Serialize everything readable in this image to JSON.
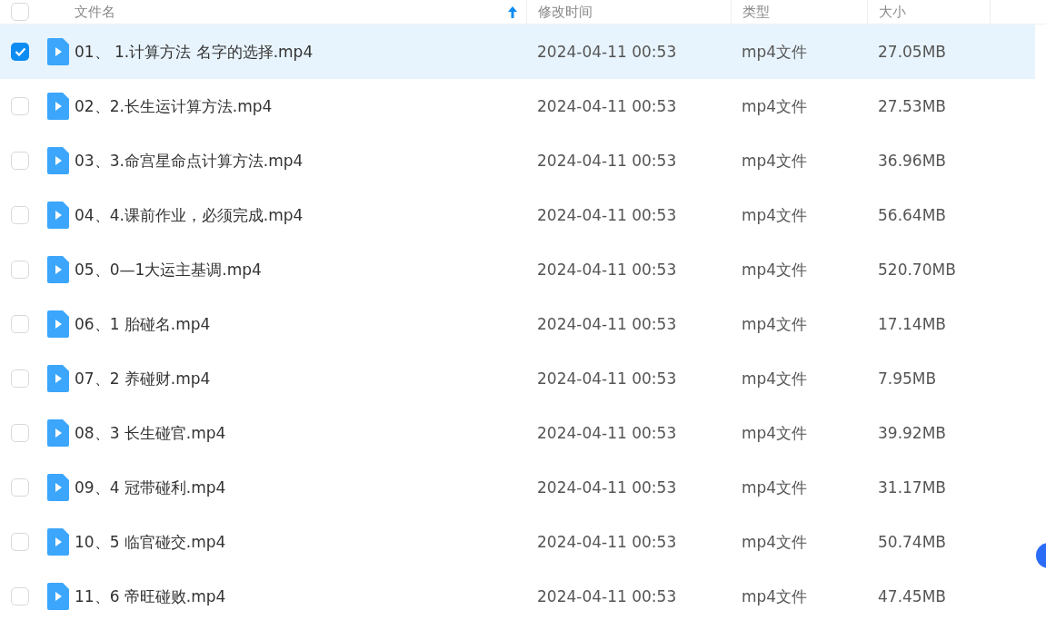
{
  "header": {
    "checked": false,
    "columns": [
      "文件名",
      "修改时间",
      "类型",
      "大小"
    ]
  },
  "rows": [
    {
      "name": "01、 1.计算方法 名字的选择.mp4",
      "modified": "2024-04-11 00:53",
      "type": "mp4文件",
      "size": "27.05MB",
      "selected": true
    },
    {
      "name": "02、2.长生运计算方法.mp4",
      "modified": "2024-04-11 00:53",
      "type": "mp4文件",
      "size": "27.53MB",
      "selected": false
    },
    {
      "name": "03、3.命宫星命点计算方法.mp4",
      "modified": "2024-04-11 00:53",
      "type": "mp4文件",
      "size": "36.96MB",
      "selected": false
    },
    {
      "name": "04、4.课前作业，必须完成.mp4",
      "modified": "2024-04-11 00:53",
      "type": "mp4文件",
      "size": "56.64MB",
      "selected": false
    },
    {
      "name": "05、0—1大运主基调.mp4",
      "modified": "2024-04-11 00:53",
      "type": "mp4文件",
      "size": "520.70MB",
      "selected": false
    },
    {
      "name": "06、1 胎碰名.mp4",
      "modified": "2024-04-11 00:53",
      "type": "mp4文件",
      "size": "17.14MB",
      "selected": false
    },
    {
      "name": "07、2 养碰财.mp4",
      "modified": "2024-04-11 00:53",
      "type": "mp4文件",
      "size": "7.95MB",
      "selected": false
    },
    {
      "name": "08、3 长生碰官.mp4",
      "modified": "2024-04-11 00:53",
      "type": "mp4文件",
      "size": "39.92MB",
      "selected": false
    },
    {
      "name": "09、4 冠带碰利.mp4",
      "modified": "2024-04-11 00:53",
      "type": "mp4文件",
      "size": "31.17MB",
      "selected": false
    },
    {
      "name": "10、5 临官碰交.mp4",
      "modified": "2024-04-11 00:53",
      "type": "mp4文件",
      "size": "50.74MB",
      "selected": false
    },
    {
      "name": "11、6 帝旺碰败.mp4",
      "modified": "2024-04-11 00:53",
      "type": "mp4文件",
      "size": "47.45MB",
      "selected": false
    }
  ]
}
